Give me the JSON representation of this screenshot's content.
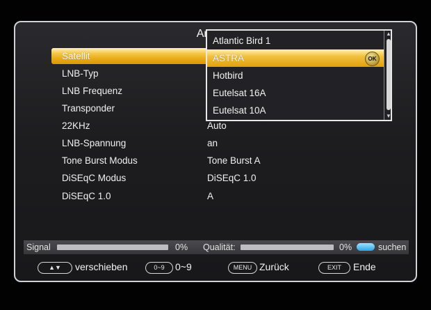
{
  "title": "Antennen",
  "rows": [
    {
      "label": "Satellit",
      "value": ""
    },
    {
      "label": "LNB-Typ",
      "value": ""
    },
    {
      "label": "LNB Frequenz",
      "value": ""
    },
    {
      "label": "Transponder",
      "value": ""
    },
    {
      "label": "22KHz",
      "value": "Auto"
    },
    {
      "label": "LNB-Spannung",
      "value": "an"
    },
    {
      "label": "Tone Burst Modus",
      "value": "Tone Burst A"
    },
    {
      "label": "DiSEqC Modus",
      "value": "DiSEqC 1.0"
    },
    {
      "label": "DiSEqC 1.0",
      "value": "A"
    }
  ],
  "dropdown": {
    "items": [
      "Atlantic Bird 1",
      "ASTRA",
      "Hotbird",
      "Eutelsat 16A",
      "Eutelsat 10A"
    ],
    "selected_index": 1,
    "ok_label": "OK"
  },
  "status": {
    "signal_label": "Signal",
    "signal_value": "0%",
    "quality_label": "Qualität:",
    "quality_value": "0%",
    "search_label": "suchen",
    "search_color": "#2aa6e6"
  },
  "footer": {
    "move_key": "▲▼",
    "move_label": "verschieben",
    "num_key": "0~9",
    "num_label": "0~9",
    "menu_key": "MENU",
    "menu_label": "Zurück",
    "exit_key": "EXIT",
    "exit_label": "Ende"
  },
  "colors": {
    "highlight": "#f2c03c",
    "background": "#1d1d20"
  }
}
